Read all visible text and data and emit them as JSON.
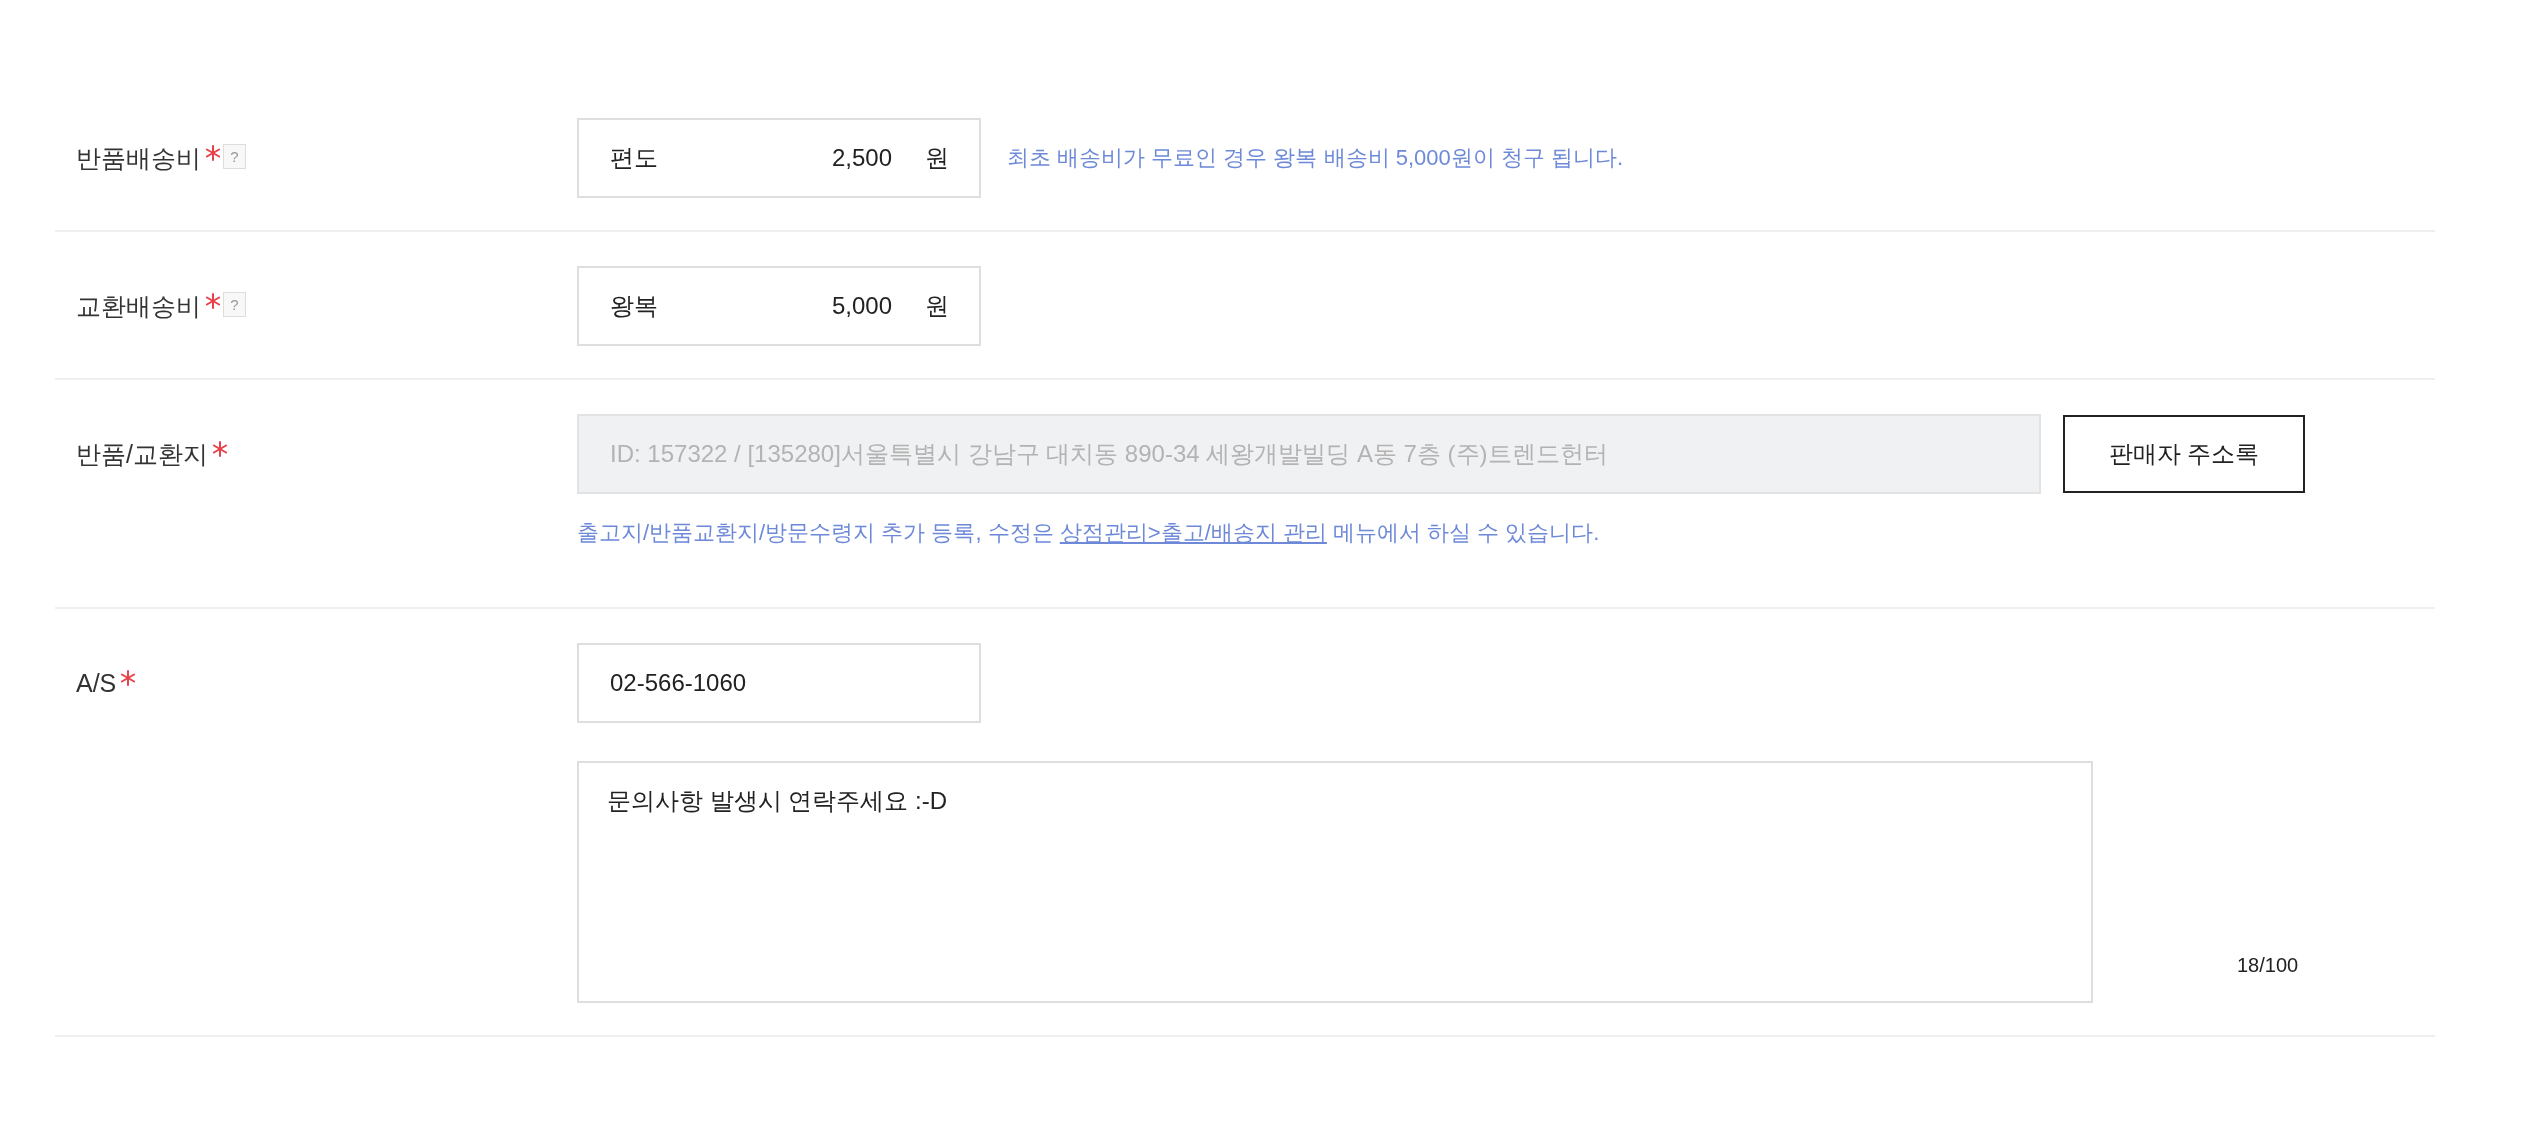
{
  "rows": [
    {
      "kind": "fee",
      "label": "반품배송비",
      "required": true,
      "help": "?",
      "field": {
        "prefix": "편도",
        "value": "2,500",
        "unit": "원"
      },
      "note": "최초 배송비가 무료인 경우 왕복 배송비 5,000원이 청구 됩니다."
    },
    {
      "kind": "fee",
      "label": "교환배송비",
      "required": true,
      "help": "?",
      "field": {
        "prefix": "왕복",
        "value": "5,000",
        "unit": "원"
      }
    },
    {
      "kind": "address",
      "label": "반품/교환지",
      "required": true,
      "field": {
        "value": "ID: 157322 / [135280]서울특별시 강남구 대치동 890-34 세왕개발빌딩 A동 7층 (주)트렌드헌터",
        "disabled": true
      },
      "button": "판매자 주소록",
      "note": {
        "before": "출고지/반품교환지/방문수령지 추가 등록, 수정은 ",
        "link": "상점관리>출고/배송지 관리",
        "after": " 메뉴에서 하실 수 있습니다."
      }
    },
    {
      "kind": "contact",
      "label": "A/S",
      "required": true,
      "phone": {
        "value": "02-566-1060"
      },
      "message": {
        "value": "문의사항 발생시 연락주세요 :-D",
        "counter": "18/100"
      }
    }
  ]
}
